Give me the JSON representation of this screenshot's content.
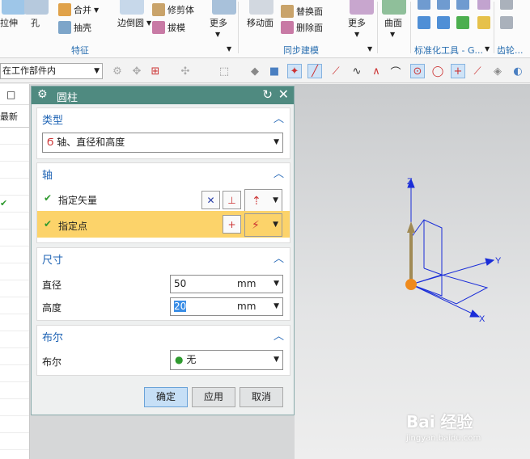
{
  "ribbon": {
    "items": {
      "extrude": "拉伸",
      "hole": "孔",
      "unite": "合并",
      "shell": "抽壳",
      "edge_blend": "边倒圆",
      "trim_body": "修剪体",
      "draft": "拔模",
      "more1": "更多",
      "move_face": "移动面",
      "replace_face": "替换面",
      "delete_face": "删除面",
      "more2": "更多",
      "surface": "曲面"
    },
    "groups": {
      "feature": "特征",
      "sync": "同步建模",
      "std_parts": "标准化工具 - G...",
      "gear": "齿轮..."
    }
  },
  "toolbar": {
    "filter_value": "在工作部件内"
  },
  "navigator": {
    "header_label": "最新"
  },
  "dialog": {
    "title": "圆柱",
    "type_section": {
      "title": "类型",
      "value": "轴、直径和高度"
    },
    "axis_section": {
      "title": "轴",
      "specify_vector": "指定矢量",
      "specify_point": "指定点"
    },
    "dimension_section": {
      "title": "尺寸",
      "diameter_label": "直径",
      "diameter_value": "50",
      "diameter_unit": "mm",
      "height_label": "高度",
      "height_value": "20",
      "height_unit": "mm"
    },
    "boolean_section": {
      "title": "布尔",
      "label": "布尔",
      "value": "无"
    },
    "buttons": {
      "ok": "确定",
      "apply": "应用",
      "cancel": "取消"
    }
  },
  "viewport": {
    "axis_x": "X",
    "axis_y": "Y",
    "axis_z": "Z"
  },
  "watermark": {
    "brand": "Bai 经验",
    "url": "jingyan.baidu.com"
  }
}
